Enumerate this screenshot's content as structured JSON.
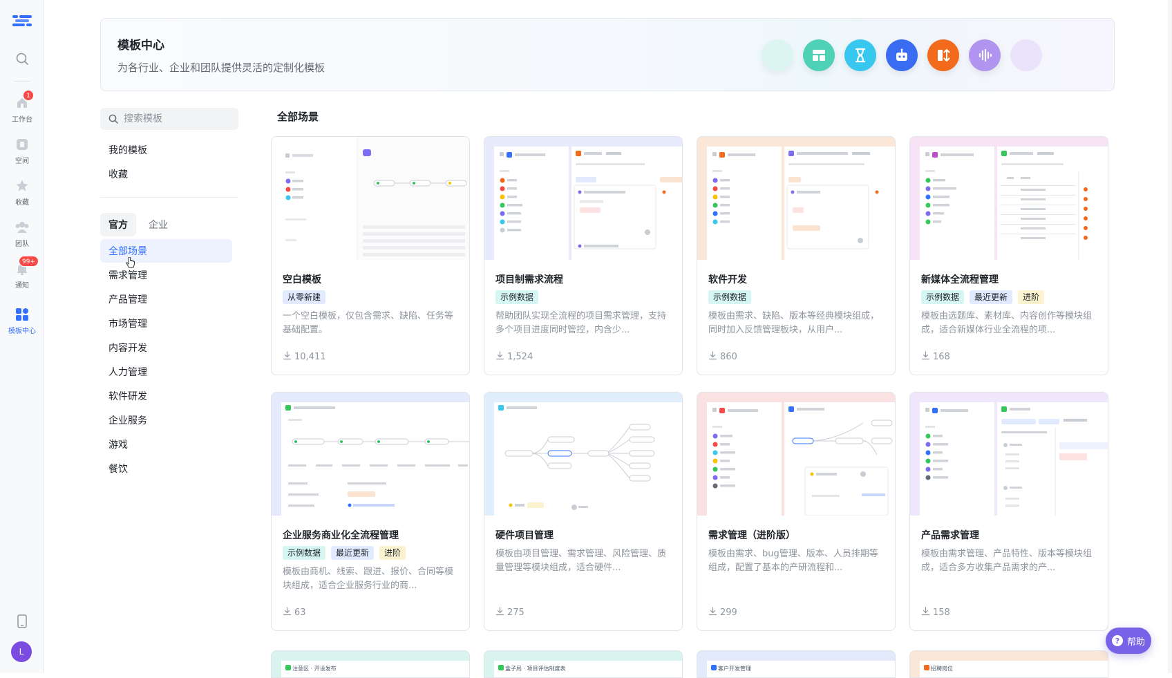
{
  "rail": {
    "items": [
      {
        "label": "",
        "icon": "search-icon"
      },
      {
        "label": "工作台",
        "icon": "home-icon",
        "badge": "1"
      },
      {
        "label": "空间",
        "icon": "space-icon"
      },
      {
        "label": "收藏",
        "icon": "star-icon"
      },
      {
        "label": "团队",
        "icon": "team-icon"
      },
      {
        "label": "通知",
        "icon": "bell-icon",
        "badge": "99+"
      },
      {
        "label": "模板中心",
        "icon": "template-grid-icon"
      }
    ],
    "avatar": "L"
  },
  "banner": {
    "title": "模板中心",
    "subtitle": "为各行业、企业和团队提供灵活的定制化模板"
  },
  "search": {
    "placeholder": "搜索模板"
  },
  "menu": {
    "my_templates": "我的模板",
    "favorites": "收藏",
    "tabs": [
      "官方",
      "企业"
    ],
    "categories": [
      "全部场景",
      "需求管理",
      "产品管理",
      "市场管理",
      "内容开发",
      "人力管理",
      "软件研发",
      "企业服务",
      "游戏",
      "餐饮"
    ]
  },
  "main": {
    "section_title": "全部场景",
    "cards": [
      {
        "name": "空白模板",
        "tags": [
          {
            "text": "从零新建",
            "color": "blue"
          }
        ],
        "desc": "一个空白模板，仅包含需求、缺陷、任务等基础配置。",
        "downloads": "10,411"
      },
      {
        "name": "项目制需求流程",
        "tags": [
          {
            "text": "示例数据",
            "color": "teal"
          }
        ],
        "desc": "帮助团队实现全流程的项目需求管理，支持多个项目进度同时管控，内含少...",
        "downloads": "1,524"
      },
      {
        "name": "软件开发",
        "tags": [
          {
            "text": "示例数据",
            "color": "teal"
          }
        ],
        "desc": "模板由需求、缺陷、版本等经典模块组成，同时加入反馈管理板块，从用户...",
        "downloads": "860"
      },
      {
        "name": "新媒体全流程管理",
        "tags": [
          {
            "text": "示例数据",
            "color": "teal"
          },
          {
            "text": "最近更新",
            "color": "blue"
          },
          {
            "text": "进阶",
            "color": "yellow"
          }
        ],
        "desc": "模板由选题库、素材库、内容创作等模块组成，适合新媒体行业全流程的项...",
        "downloads": "168"
      },
      {
        "name": "企业服务商业化全流程管理",
        "tags": [
          {
            "text": "示例数据",
            "color": "teal"
          },
          {
            "text": "最近更新",
            "color": "blue"
          },
          {
            "text": "进阶",
            "color": "yellow"
          }
        ],
        "desc": "模板由商机、线索、跟进、报价、合同等模块组成，适合企业服务行业的商...",
        "downloads": "63"
      },
      {
        "name": "硬件项目管理",
        "tags": [],
        "desc": "模板由项目管理、需求管理、风险管理、质量管理等模块组成，适合硬件...",
        "downloads": "275"
      },
      {
        "name": "需求管理（进阶版）",
        "tags": [],
        "desc": "模板由需求、bug管理、版本、人员排期等组成，配置了基本的产研流程和...",
        "downloads": "299"
      },
      {
        "name": "产品需求管理",
        "tags": [],
        "desc": "模板由需求管理、产品特性、版本等模块组成，适合多方收集产品需求的产...",
        "downloads": "158"
      }
    ],
    "peek_cards": [
      "注意区 · 开设发布",
      "盒子局 · 项目评估制度表",
      "客户开发管理",
      "招聘岗位"
    ]
  },
  "help": {
    "label": "帮助"
  },
  "colors": {
    "accent": "#3370ff",
    "tag_blue": "#e1eaff",
    "tag_teal": "#d5f6f2",
    "tag_yellow": "#fbf3cf"
  }
}
